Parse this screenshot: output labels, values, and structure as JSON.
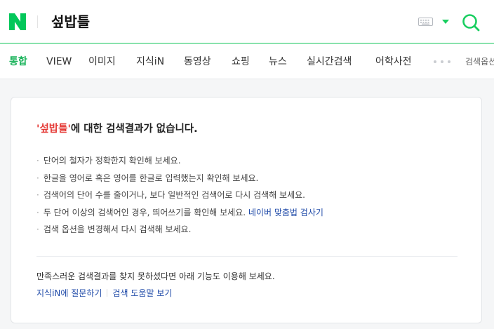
{
  "header": {
    "logo_letter": "N",
    "query": "섶밥틀",
    "icons": {
      "keyboard": "keyboard-icon",
      "dropdown": "caret-down-icon",
      "search": "search-icon"
    }
  },
  "tabs": [
    {
      "label": "통합",
      "active": true
    },
    {
      "label": "VIEW"
    },
    {
      "label": "이미지"
    },
    {
      "label": "지식iN"
    },
    {
      "label": "동영상"
    },
    {
      "label": "쇼핑"
    },
    {
      "label": "뉴스"
    },
    {
      "label": "실시간검색"
    },
    {
      "label": "어학사전"
    }
  ],
  "search_option_label": "검색옵션",
  "result": {
    "query_quoted": "'섶밥틀'",
    "title_suffix": "에 대한 검색결과가 없습니다.",
    "tips": [
      "단어의 철자가 정확한지 확인해 보세요.",
      "한글을 영어로 혹은 영어를 한글로 입력했는지 확인해 보세요.",
      "검색어의 단어 수를 줄이거나, 보다 일반적인 검색어로 다시 검색해 보세요.",
      "두 단어 이상의 검색어인 경우, 띄어쓰기를 확인해 보세요.",
      "검색 옵션을 변경해서 다시 검색해 보세요."
    ],
    "tip_link": "네이버 맞춤법 검사기",
    "help_text": "만족스러운 검색결과를 찾지 못하셨다면 아래 기능도 이용해 보세요.",
    "help_links": [
      "지식iN에 질문하기",
      "검색 도움말 보기"
    ]
  },
  "colors": {
    "brand": "#03c75a",
    "accent_line": "#19ce60",
    "highlight": "#e53935",
    "link": "#1f4aa8"
  }
}
